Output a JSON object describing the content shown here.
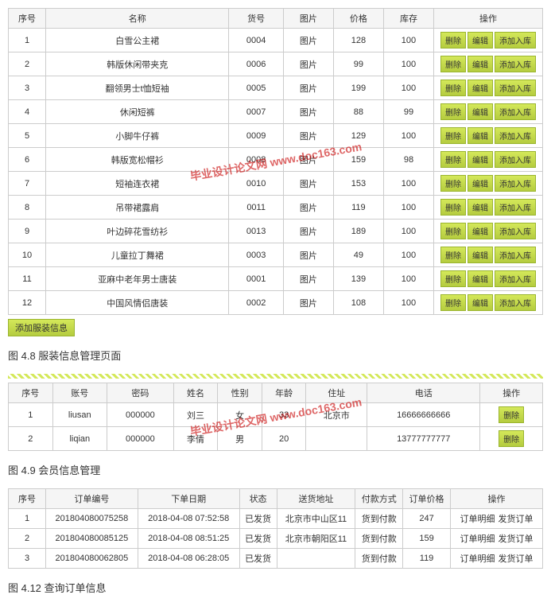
{
  "table1": {
    "headers": [
      "序号",
      "名称",
      "货号",
      "图片",
      "价格",
      "库存",
      "操作"
    ],
    "rows": [
      {
        "n": "1",
        "name": "白雪公主裙",
        "code": "0004",
        "img": "图片",
        "price": "128",
        "stock": "100"
      },
      {
        "n": "2",
        "name": "韩版休闲带夹克",
        "code": "0006",
        "img": "图片",
        "price": "99",
        "stock": "100"
      },
      {
        "n": "3",
        "name": "翻领男士t恤短袖",
        "code": "0005",
        "img": "图片",
        "price": "199",
        "stock": "100"
      },
      {
        "n": "4",
        "name": "休闲短裤",
        "code": "0007",
        "img": "图片",
        "price": "88",
        "stock": "99"
      },
      {
        "n": "5",
        "name": "小脚牛仔裤",
        "code": "0009",
        "img": "图片",
        "price": "129",
        "stock": "100"
      },
      {
        "n": "6",
        "name": "韩版宽松帽衫",
        "code": "0008",
        "img": "图片",
        "price": "159",
        "stock": "98"
      },
      {
        "n": "7",
        "name": "短袖连衣裙",
        "code": "0010",
        "img": "图片",
        "price": "153",
        "stock": "100"
      },
      {
        "n": "8",
        "name": "吊带裙露肩",
        "code": "0011",
        "img": "图片",
        "price": "119",
        "stock": "100"
      },
      {
        "n": "9",
        "name": "叶边碎花雪纺衫",
        "code": "0013",
        "img": "图片",
        "price": "189",
        "stock": "100"
      },
      {
        "n": "10",
        "name": "儿童拉丁舞裙",
        "code": "0003",
        "img": "图片",
        "price": "49",
        "stock": "100"
      },
      {
        "n": "11",
        "name": "亚麻中老年男士唐装",
        "code": "0001",
        "img": "图片",
        "price": "139",
        "stock": "100"
      },
      {
        "n": "12",
        "name": "中国风情侣唐装",
        "code": "0002",
        "img": "图片",
        "price": "108",
        "stock": "100"
      }
    ],
    "ops": {
      "del": "删除",
      "edit": "编辑",
      "add": "添加入库"
    },
    "addBtn": "添加服装信息"
  },
  "cap1": "图 4.8 服装信息管理页面",
  "table2": {
    "headers": [
      "序号",
      "账号",
      "密码",
      "姓名",
      "性别",
      "年龄",
      "住址",
      "电话",
      "操作"
    ],
    "rows": [
      {
        "n": "1",
        "acc": "liusan",
        "pwd": "000000",
        "name": "刘三",
        "sex": "女",
        "age": "33",
        "addr": "北京市",
        "tel": "16666666666"
      },
      {
        "n": "2",
        "acc": "liqian",
        "pwd": "000000",
        "name": "李倩",
        "sex": "男",
        "age": "20",
        "addr": "",
        "tel": "13777777777"
      }
    ],
    "op": "删除"
  },
  "cap2": "图 4.9 会员信息管理",
  "table3": {
    "headers": [
      "序号",
      "订单编号",
      "下单日期",
      "状态",
      "送货地址",
      "付款方式",
      "订单价格",
      "操作"
    ],
    "rows": [
      {
        "n": "1",
        "oid": "201804080075258",
        "date": "2018-04-08 07:52:58",
        "st": "已发货",
        "addr": "北京市中山区11",
        "pay": "货到付款",
        "price": "247"
      },
      {
        "n": "2",
        "oid": "201804080085125",
        "date": "2018-04-08 08:51:25",
        "st": "已发货",
        "addr": "北京市朝阳区11",
        "pay": "货到付款",
        "price": "159"
      },
      {
        "n": "3",
        "oid": "201804080062805",
        "date": "2018-04-08 06:28:05",
        "st": "已发货",
        "addr": "",
        "pay": "货到付款",
        "price": "119"
      }
    ],
    "ops": {
      "detail": "订单明细",
      "ship": "发货订单"
    }
  },
  "cap3": "图 4.12 查询订单信息"
}
